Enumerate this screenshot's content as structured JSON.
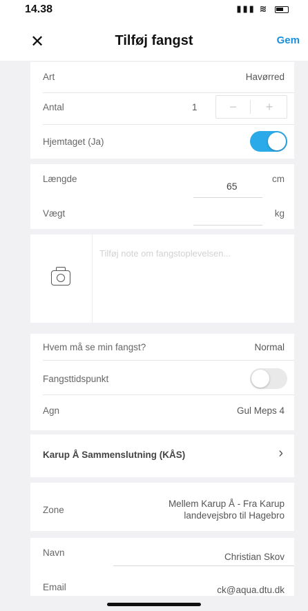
{
  "status_bar": {
    "time": "14.38",
    "signal": "▮▮▮",
    "wifi": "≋"
  },
  "nav": {
    "title": "Tilføj fangst",
    "close_label": "✕",
    "save_label": "Gem"
  },
  "catch": {
    "art_label": "Art",
    "art_value": "Havørred",
    "antal_label": "Antal",
    "antal_value": "1",
    "minus": "−",
    "plus": "+",
    "hjemtaget_label": "Hjemtaget (Ja)",
    "hjemtaget_on": true
  },
  "measure": {
    "laengde_label": "Længde",
    "laengde_value": "65",
    "laengde_unit": "cm",
    "vaegt_label": "Vægt",
    "vaegt_value": "",
    "vaegt_unit": "kg"
  },
  "note": {
    "placeholder": "Tilføj note om fangstoplevelsen..."
  },
  "settings": {
    "visibility_label": "Hvem må se min fangst?",
    "visibility_value": "Normal",
    "time_label": "Fangsttidspunkt",
    "time_on": false,
    "bait_label": "Agn",
    "bait_value": "Gul Meps 4"
  },
  "association": {
    "label": "Karup Å Sammenslutning (KÅS)",
    "chevron": "›"
  },
  "zone": {
    "label": "Zone",
    "value_line1": "Mellem Karup Å - Fra Karup",
    "value_line2": "landevejsbro til Hagebro"
  },
  "person": {
    "name_label": "Navn",
    "name_value": "Christian Skov",
    "email_label": "Email",
    "email_value": "ck@aqua.dtu.dk"
  },
  "colors": {
    "accent": "#2aaae8",
    "save": "#1a8fdc",
    "background": "#f1f1f3"
  }
}
